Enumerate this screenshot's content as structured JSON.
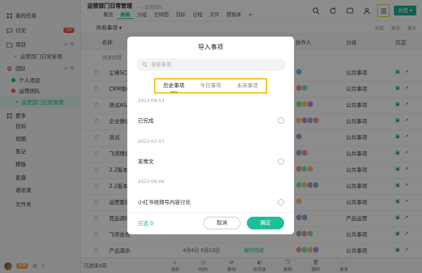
{
  "sidebar": {
    "items": [
      {
        "label": "我的任务",
        "icon": "task-icon"
      },
      {
        "label": "讨论",
        "icon": "chat-icon",
        "badge": "10"
      },
      {
        "label": "项目",
        "icon": "folder-icon"
      },
      {
        "label": "运营部门日常管理",
        "sub": true
      },
      {
        "label": "团队",
        "icon": "team-icon"
      },
      {
        "label": "个人项目",
        "sub": true
      },
      {
        "label": "运营团队",
        "sub": true
      },
      {
        "label": "运营部门日常管理",
        "sub": true,
        "active": true
      },
      {
        "label": "更多",
        "icon": "more-icon"
      },
      {
        "label": "目标"
      },
      {
        "label": "视图"
      },
      {
        "label": "笔记"
      },
      {
        "label": "模版"
      },
      {
        "label": "复盘"
      },
      {
        "label": "通讯录"
      },
      {
        "label": "文件夹"
      }
    ],
    "vip_label": "会员"
  },
  "header": {
    "project_title": "运营部门日常管理",
    "project_sub": "— 运营团队",
    "tabs": [
      "概览",
      "表格",
      "分组",
      "甘特图",
      "目标",
      "日程",
      "文件",
      "模板库",
      "+"
    ],
    "active_tab": 1,
    "create_label": "创建"
  },
  "toolbar": {
    "all_items": "所有事项",
    "right": [
      "分区",
      "显示",
      "表头"
    ]
  },
  "table": {
    "columns": [
      "名称",
      "协作人",
      "分组",
      "沉淀"
    ],
    "quick_create": "快速创建",
    "rows": [
      {
        "name": "尘锋SCRM",
        "group": "公共事项"
      },
      {
        "name": "CRM报价",
        "group": "公共事项"
      },
      {
        "name": "测试ASA",
        "group": "公共事项"
      },
      {
        "name": "企业微信",
        "group": "公共事项"
      },
      {
        "name": "测试",
        "group": "公共事项"
      },
      {
        "name": "飞项理念",
        "group": "公共事项"
      },
      {
        "name": "2.2版本",
        "group": "公共事项"
      },
      {
        "name": "2.2版本",
        "group": "公共事项"
      },
      {
        "name": "运营整体",
        "group": "公共事项"
      },
      {
        "name": "竞品调研",
        "group": "产品运营"
      },
      {
        "name": "飞项会员",
        "group": "公共事项"
      },
      {
        "name": "产品演示考核",
        "group": "公共事项",
        "date": "4月4日 5月13日",
        "status": "按时完成"
      }
    ]
  },
  "bottombar": {
    "selected": "已选择3项",
    "actions": [
      "添加",
      "时间",
      "移动",
      "优先级",
      "复制",
      "删除",
      "更多"
    ]
  },
  "modal": {
    "title": "导入事项",
    "search_placeholder": "搜索事项",
    "tabs": [
      "历史事项",
      "今日事项",
      "未来事项"
    ],
    "active_tab": 0,
    "groups": [
      {
        "date": "2023-09-13",
        "item": "已完成"
      },
      {
        "date": "2023-07-07",
        "item": "发推文"
      },
      {
        "date": "2023-04-06",
        "item": "小红书视频号内容讨论"
      }
    ],
    "selected_label": "已选 0",
    "cancel_label": "取消",
    "ok_label": "确定"
  },
  "colors": {
    "accent": "#17b48c",
    "highlight": "#f2c21a",
    "badge": "#f05454"
  }
}
